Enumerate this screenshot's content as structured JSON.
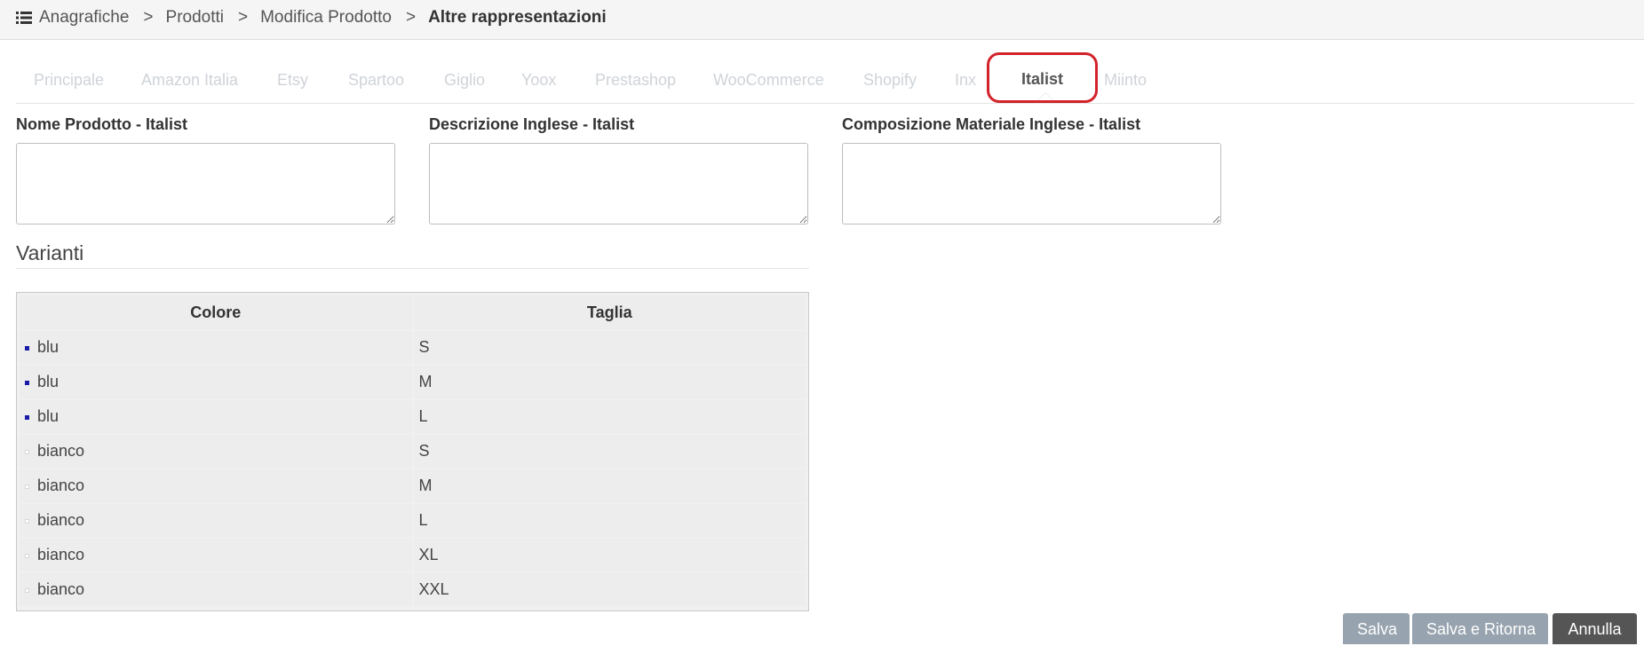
{
  "breadcrumb": {
    "items": [
      "Anagrafiche",
      "Prodotti",
      "Modifica Prodotto"
    ],
    "separator": ">",
    "current": "Altre rappresentazioni"
  },
  "tabs": [
    {
      "label": "Principale"
    },
    {
      "label": "Amazon Italia"
    },
    {
      "label": "Etsy"
    },
    {
      "label": "Spartoo"
    },
    {
      "label": "Giglio"
    },
    {
      "label": "Yoox"
    },
    {
      "label": "Prestashop"
    },
    {
      "label": "WooCommerce"
    },
    {
      "label": "Shopify"
    },
    {
      "label": "Inx"
    },
    {
      "label": "Italist",
      "active": true
    },
    {
      "label": "Miinto"
    }
  ],
  "fields": {
    "nome_prodotto": {
      "label": "Nome Prodotto - Italist",
      "value": ""
    },
    "descrizione_inglese": {
      "label": "Descrizione Inglese - Italist",
      "value": ""
    },
    "composizione_materiale": {
      "label": "Composizione Materiale Inglese - Italist",
      "value": ""
    }
  },
  "varianti": {
    "title": "Varianti",
    "columns": {
      "colore": "Colore",
      "taglia": "Taglia"
    },
    "rows": [
      {
        "colore": "blu",
        "taglia": "S",
        "swatch": "#1a1aa8"
      },
      {
        "colore": "blu",
        "taglia": "M",
        "swatch": "#1a1aa8"
      },
      {
        "colore": "blu",
        "taglia": "L",
        "swatch": "#1a1aa8"
      },
      {
        "colore": "bianco",
        "taglia": "S",
        "swatch": "#ffffff"
      },
      {
        "colore": "bianco",
        "taglia": "M",
        "swatch": "#ffffff"
      },
      {
        "colore": "bianco",
        "taglia": "L",
        "swatch": "#ffffff"
      },
      {
        "colore": "bianco",
        "taglia": "XL",
        "swatch": "#ffffff"
      },
      {
        "colore": "bianco",
        "taglia": "XXL",
        "swatch": "#ffffff"
      }
    ]
  },
  "actions": {
    "save": "Salva",
    "save_return": "Salva e Ritorna",
    "cancel": "Annulla"
  },
  "icons": {
    "breadcrumb_menu": "list-icon"
  },
  "colors": {
    "highlight": "#d2232a",
    "button_primary": "#97a3ae",
    "button_dark": "#555555"
  }
}
